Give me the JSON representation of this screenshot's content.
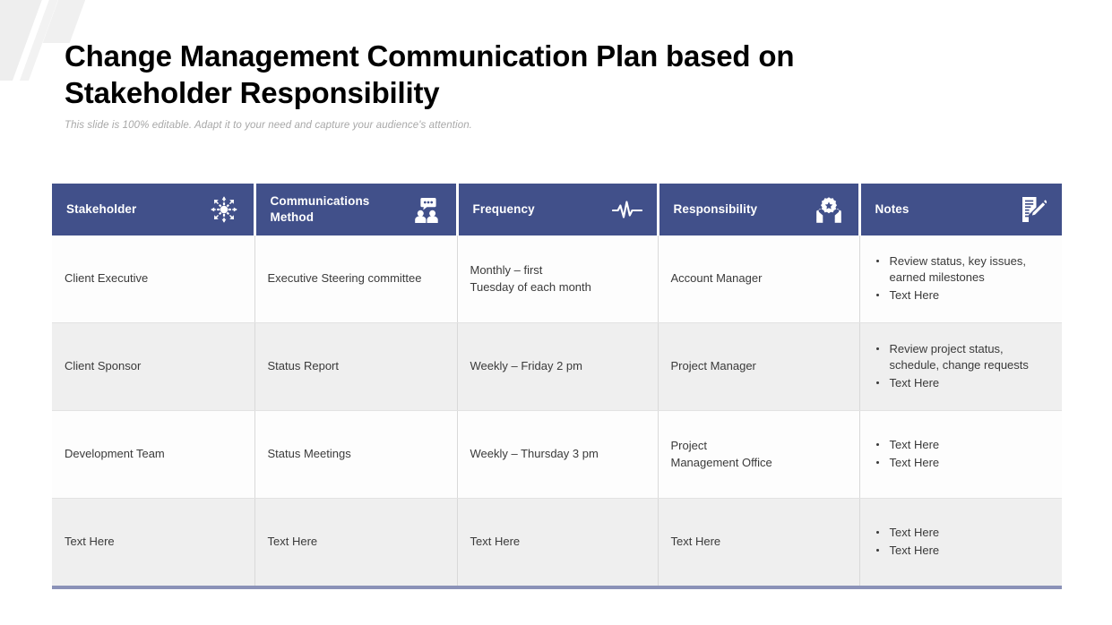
{
  "slide": {
    "title": "Change Management Communication Plan based on Stakeholder Responsibility",
    "subtitle": "This slide is 100% editable. Adapt it to your need and capture your audience's attention.",
    "accent_color": "#41508a",
    "row_alt_color": "#efefef",
    "bottom_rule_color": "#8b92b8"
  },
  "table": {
    "columns": [
      {
        "label": "Stakeholder",
        "icon": "gear-arrows-icon"
      },
      {
        "label": "Communications\nMethod",
        "icon": "people-speech-bubble-icon"
      },
      {
        "label": "Frequency",
        "icon": "pulse-wave-icon"
      },
      {
        "label": "Responsibility",
        "icon": "hands-holding-gear-icon"
      },
      {
        "label": "Notes",
        "icon": "document-pencil-icon"
      }
    ],
    "rows": [
      {
        "stakeholder": "Client Executive",
        "method": "Executive Steering committee",
        "frequency": "Monthly – first\nTuesday of each month",
        "responsibility": "Account Manager",
        "notes": [
          "Review status, key issues,\nearned milestones",
          "Text Here"
        ]
      },
      {
        "stakeholder": "Client Sponsor",
        "method": "Status Report",
        "frequency": "Weekly – Friday 2 pm",
        "responsibility": "Project Manager",
        "notes": [
          "Review project status,\nschedule, change requests",
          "Text Here"
        ]
      },
      {
        "stakeholder": "Development Team",
        "method": "Status Meetings",
        "frequency": "Weekly – Thursday 3 pm",
        "responsibility": "Project\nManagement Office",
        "notes": [
          "Text Here",
          "Text Here"
        ]
      },
      {
        "stakeholder": "Text Here",
        "method": "Text Here",
        "frequency": "Text Here",
        "responsibility": "Text Here",
        "notes": [
          "Text Here",
          "Text Here"
        ]
      }
    ]
  }
}
